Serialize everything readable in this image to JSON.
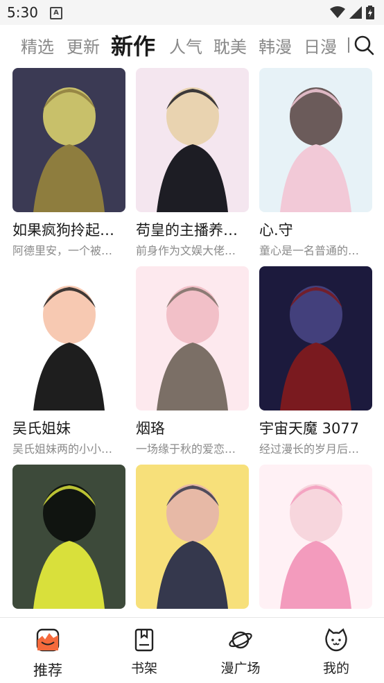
{
  "status": {
    "time": "5:30",
    "notification_icon": "A"
  },
  "tabs": [
    {
      "label": "精选"
    },
    {
      "label": "更新"
    },
    {
      "label": "新作"
    },
    {
      "label": "人气"
    },
    {
      "label": "耽美"
    },
    {
      "label": "韩漫"
    },
    {
      "label": "日漫"
    }
  ],
  "active_tab": "新作",
  "comics": [
    {
      "title": "如果疯狗拎起…",
      "desc": "阿德里安，一个被…",
      "palette": [
        "#3b3a54",
        "#8e7d3e",
        "#c8c06a"
      ]
    },
    {
      "title": "苟皇的主播养…",
      "desc": "前身作为文娱大佬…",
      "palette": [
        "#f4e6ef",
        "#1d1d24",
        "#e9d3b0"
      ]
    },
    {
      "title": "心.守",
      "desc": "童心是一名普通的…",
      "palette": [
        "#e7f2f7",
        "#f2c9d7",
        "#6b5b5a"
      ]
    },
    {
      "title": "吴氏姐妹",
      "desc": "吴氏姐妹两的小小…",
      "palette": [
        "#ffffff",
        "#1e1e1e",
        "#f7c9b2"
      ]
    },
    {
      "title": "烟珞",
      "desc": "一场缘于秋的爱恋…",
      "palette": [
        "#fde9ee",
        "#7b6f66",
        "#f2c0c8"
      ]
    },
    {
      "title": "宇宙天魔 3077",
      "desc": "经过漫长的岁月后…",
      "palette": [
        "#1c1a3d",
        "#7a1a1f",
        "#43407c"
      ]
    },
    {
      "title": "",
      "desc": "",
      "palette": [
        "#3d4a3a",
        "#d9e03b",
        "#101410"
      ]
    },
    {
      "title": "",
      "desc": "",
      "palette": [
        "#f7e07a",
        "#35384d",
        "#e7b9a6"
      ]
    },
    {
      "title": "",
      "desc": "",
      "palette": [
        "#fff1f5",
        "#f39bbd",
        "#f7d6dd"
      ]
    }
  ],
  "bottom_nav": [
    {
      "label": "推荐",
      "icon": "recommend-icon"
    },
    {
      "label": "书架",
      "icon": "bookshelf-icon"
    },
    {
      "label": "漫广场",
      "icon": "planet-icon"
    },
    {
      "label": "我的",
      "icon": "cat-face-icon"
    }
  ]
}
